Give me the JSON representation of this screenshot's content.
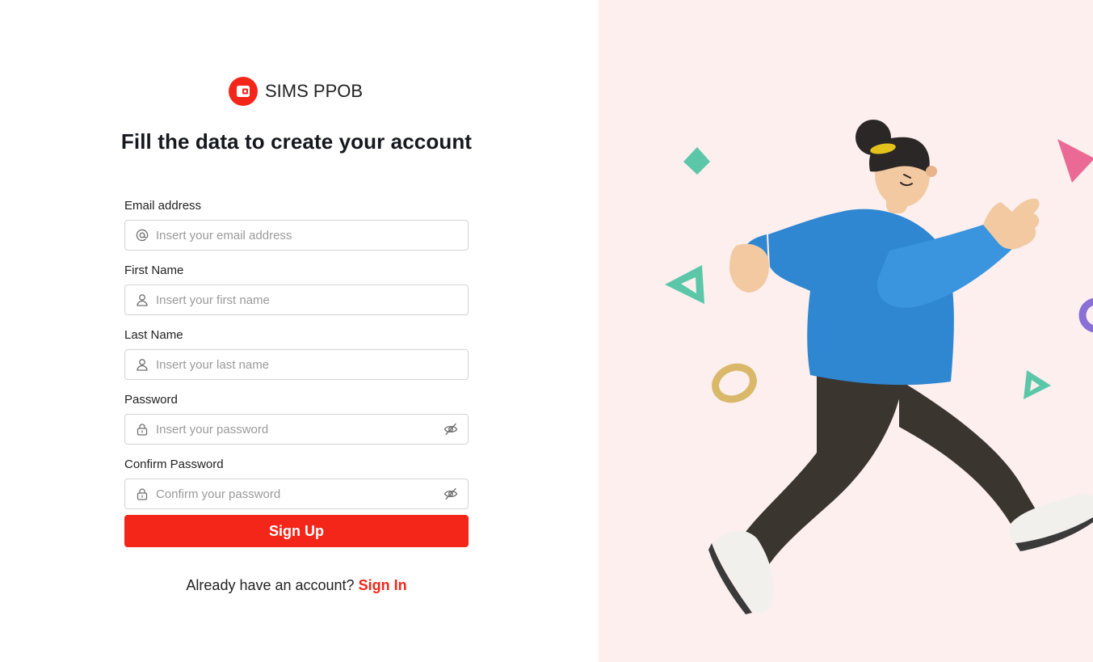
{
  "brand": {
    "name": "SIMS PPOB",
    "logo": "wallet-logo",
    "color": "#f42619"
  },
  "heading": "Fill the data to create your account",
  "form": {
    "email": {
      "label": "Email address",
      "placeholder": "Insert your email address",
      "icon": "at-icon"
    },
    "first_name": {
      "label": "First Name",
      "placeholder": "Insert your first name",
      "icon": "user-icon"
    },
    "last_name": {
      "label": "Last Name",
      "placeholder": "Insert your last name",
      "icon": "user-icon"
    },
    "password": {
      "label": "Password",
      "placeholder": "Insert your password",
      "icon": "lock-icon",
      "toggle_icon": "eye-off-icon"
    },
    "confirm_password": {
      "label": "Confirm Password",
      "placeholder": "Confirm your password",
      "icon": "lock-icon",
      "toggle_icon": "eye-off-icon"
    },
    "submit_label": "Sign Up"
  },
  "signin": {
    "prompt": "Already have an account?",
    "link_label": "Sign In"
  },
  "illustration": {
    "background": "#fcefee",
    "accent": "#f42619"
  }
}
